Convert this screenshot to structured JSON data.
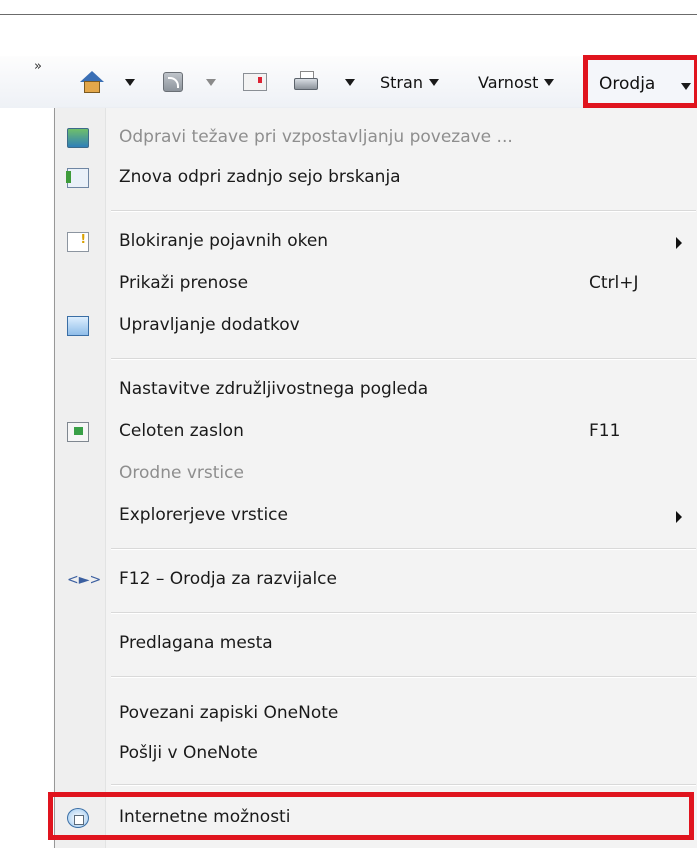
{
  "toolbar": {
    "overflow_chevron": "»",
    "home_icon": "home-icon",
    "feeds_icon": "feeds-icon",
    "read_mail_icon": "read-mail-icon",
    "print_icon": "print-icon",
    "page_label": "Stran",
    "safety_label": "Varnost",
    "tools_label": "Orodja",
    "highlight_color": "#e0141e"
  },
  "menu": {
    "items": [
      {
        "label": "Odpravi težave pri vzpostavljanju povezave ...",
        "icon": "network-diagnostics-icon",
        "disabled": true,
        "accelerator": "",
        "submenu": false
      },
      {
        "label": "Znova odpri zadnjo sejo brskanja",
        "icon": "reopen-session-icon",
        "disabled": false,
        "accelerator": "",
        "submenu": false
      },
      {
        "label": "Blokiranje pojavnih oken",
        "icon": "popup-blocker-icon",
        "disabled": false,
        "accelerator": "",
        "submenu": true
      },
      {
        "label": "Prikaži prenose",
        "icon": "",
        "disabled": false,
        "accelerator": "Ctrl+J",
        "submenu": false
      },
      {
        "label": "Upravljanje dodatkov",
        "icon": "manage-addons-icon",
        "disabled": false,
        "accelerator": "",
        "submenu": false
      },
      {
        "label": "Nastavitve združljivostnega pogleda",
        "icon": "",
        "disabled": false,
        "accelerator": "",
        "submenu": false
      },
      {
        "label": "Celoten zaslon",
        "icon": "fullscreen-icon",
        "disabled": false,
        "accelerator": "F11",
        "submenu": false
      },
      {
        "label": "Orodne vrstice",
        "icon": "",
        "disabled": true,
        "accelerator": "",
        "submenu": false
      },
      {
        "label": "Explorerjeve vrstice",
        "icon": "",
        "disabled": false,
        "accelerator": "",
        "submenu": true
      },
      {
        "label": "F12 – Orodja za razvijalce",
        "icon": "developer-tools-icon",
        "disabled": false,
        "accelerator": "",
        "submenu": false
      },
      {
        "label": "Predlagana mesta",
        "icon": "",
        "disabled": false,
        "accelerator": "",
        "submenu": false
      },
      {
        "label": "Povezani zapiski OneNote",
        "icon": "",
        "disabled": false,
        "accelerator": "",
        "submenu": false
      },
      {
        "label": "Pošlji v OneNote",
        "icon": "",
        "disabled": false,
        "accelerator": "",
        "submenu": false
      },
      {
        "label": "Internetne možnosti",
        "icon": "internet-options-icon",
        "disabled": false,
        "accelerator": "",
        "submenu": false
      }
    ]
  }
}
